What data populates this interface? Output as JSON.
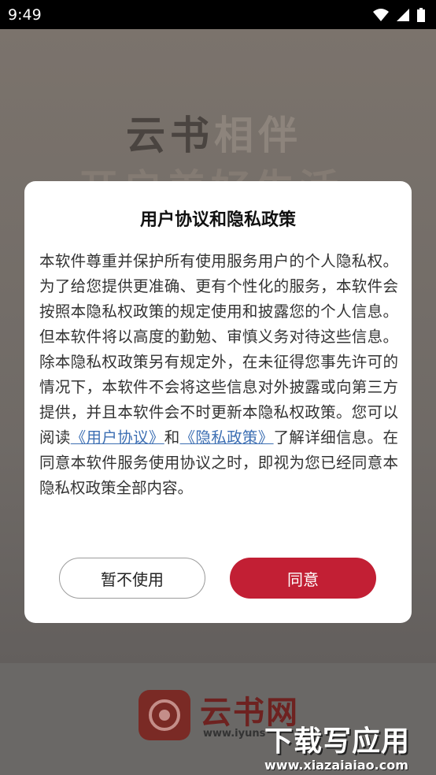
{
  "status_bar": {
    "time": "9:49"
  },
  "background": {
    "title_dark": "云书",
    "title_light": "相伴",
    "subtitle": "开启美好生活",
    "logo_text": "云书网",
    "logo_url": "www.iyuns",
    "watermark_main": "下载写应用",
    "watermark_url": "www.xiazaiaiao.com"
  },
  "dialog": {
    "title": "用户协议和隐私政策",
    "body_part1": "本软件尊重并保护所有使用服务用户的个人隐私权。为了给您提供更准确、更有个性化的服务，本软件会按照本隐私权政策的规定使用和披露您的个人信息。但本软件将以高度的勤勉、审慎义务对待这些信息。除本隐私权政策另有规定外，在未征得您事先许可的情况下，本软件不会将这些信息对外披露或向第三方提供，并且本软件会不时更新本隐私权政策。您可以阅读",
    "link_user_agreement": "《用户协议》",
    "body_and": "和",
    "link_privacy_policy": "《隐私政策》",
    "body_part2": "了解详细信息。在同意本软件服务使用协议之时，即视为您已经同意本隐私权政策全部内容。",
    "cancel_label": "暂不使用",
    "agree_label": "同意"
  },
  "colors": {
    "accent": "#c21f34",
    "link": "#3d6fb3"
  }
}
